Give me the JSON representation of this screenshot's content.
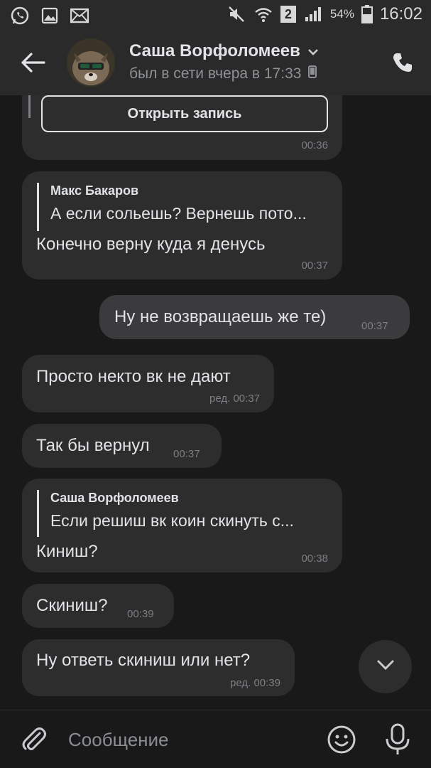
{
  "status_bar": {
    "battery_percent": "54%",
    "sim_indicator": "2",
    "time": "16:02",
    "left_icons": [
      "whatsapp-icon",
      "gallery-icon",
      "mail-icon"
    ],
    "right_icons": [
      "mute-icon",
      "wifi-icon",
      "signal-icon",
      "battery-icon"
    ]
  },
  "header": {
    "name": "Саша Ворфоломеев",
    "status": "был в сети вчера в 17:33"
  },
  "messages": [
    {
      "id": "m0",
      "direction": "in",
      "button": "Открыть запись",
      "time": "00:36"
    },
    {
      "id": "m1",
      "direction": "in",
      "quote": {
        "author": "Макс Бакаров",
        "text": "А если сольешь? Вернешь пото..."
      },
      "text": "Конечно верну куда я денусь",
      "time": "00:37"
    },
    {
      "id": "m2",
      "direction": "out",
      "text": "Ну не возвращаешь же те)",
      "time": "00:37"
    },
    {
      "id": "m3",
      "direction": "in",
      "text": "Просто некто вк не дают",
      "time": "ред. 00:37"
    },
    {
      "id": "m4",
      "direction": "in",
      "text": "Так бы вернул",
      "time": "00:37"
    },
    {
      "id": "m5",
      "direction": "in",
      "quote": {
        "author": "Саша Ворфоломеев",
        "text": "Если решиш вк коин скинуть с..."
      },
      "text": "Киниш?",
      "time": "00:38"
    },
    {
      "id": "m6",
      "direction": "in",
      "text": "Скиниш?",
      "time": "00:39"
    },
    {
      "id": "m7",
      "direction": "in",
      "text": "Ну ответь скиниш или нет?",
      "time": "ред. 00:39"
    }
  ],
  "composer": {
    "placeholder": "Сообщение"
  },
  "colors": {
    "background": "#19191a",
    "bar": "#2a2a2b",
    "bubble_in": "#2d2d2e",
    "bubble_out": "#3b3b3d",
    "text": "#e1e3e6",
    "muted": "#8e9196"
  }
}
